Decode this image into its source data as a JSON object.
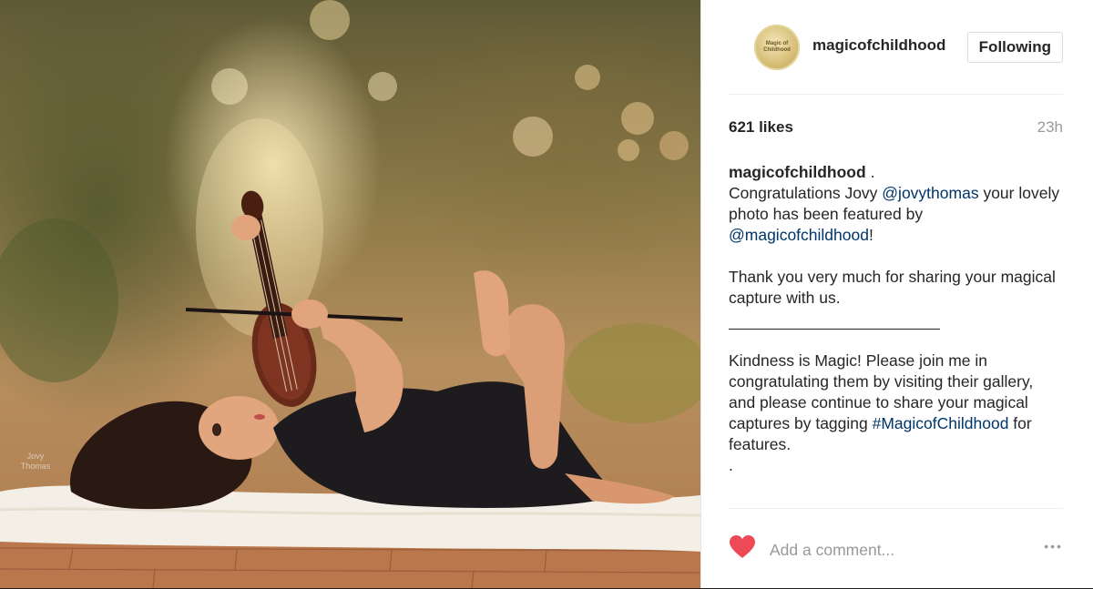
{
  "photo": {
    "alt_subject": "photo",
    "watermark": "Jovy Thomas"
  },
  "header": {
    "avatar_text": "Magic of Childhood",
    "username": "magicofchildhood",
    "follow_label": "Following"
  },
  "stats": {
    "likes": "621 likes",
    "time": "23h"
  },
  "caption": {
    "username": "magicofchildhood",
    "after_username": " .",
    "line1_start": "Congratulations Jovy ",
    "mention1": "@jovythomas",
    "line1_end": " your lovely photo has been featured by ",
    "mention2": "@magicofchildhood",
    "line1_tail": "!",
    "para2": "Thank you very much for sharing your magical capture with us.",
    "para3_start": "Kindness is Magic! Please join me in congratulating them by visiting their gallery, and please continue to share your magical captures by tagging ",
    "hashtag": "#MagicofChildhood",
    "para3_end": " for features.",
    "trailing_dot": "."
  },
  "footer": {
    "comment_placeholder": "Add a comment...",
    "more_label": "•••",
    "heart_color": "#ed4956"
  }
}
